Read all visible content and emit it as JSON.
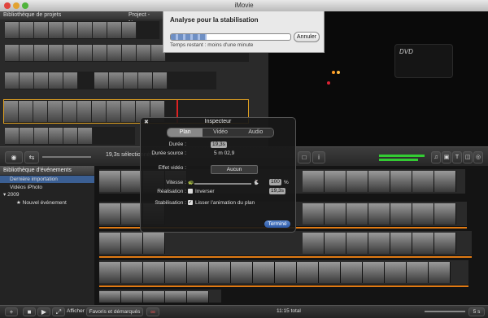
{
  "window": {
    "title": "iMovie"
  },
  "project_library": {
    "header": "Bibliothèque de projets",
    "project_name": "Project - Nouve..."
  },
  "viewer": {
    "dvd_label": "DVD"
  },
  "analysis": {
    "title": "Analyse pour la stabilisation",
    "progress": 0.3,
    "cancel_label": "Annuler",
    "remaining": "Temps restant : moins d'une minute"
  },
  "toolbar": {
    "selection": "19,3s sélectionné(e)"
  },
  "event_library": {
    "header": "Bibliothèque d'événements",
    "items": [
      {
        "label": "Dernière importation"
      },
      {
        "label": "Vidéos iPhoto"
      },
      {
        "label": "2009"
      },
      {
        "label": "Nouvel événement"
      }
    ]
  },
  "inspector": {
    "title": "Inspecteur",
    "tabs": [
      {
        "label": "Plan"
      },
      {
        "label": "Vidéo"
      },
      {
        "label": "Audio"
      }
    ],
    "duration_label": "Durée :",
    "duration_value": "19,3s",
    "source_duration_label": "Durée source :",
    "source_duration_value": "5 m 02,9",
    "video_effect_label": "Effet vidéo :",
    "video_effect_value": "Aucun",
    "speed_label": "Vitesse :",
    "speed_value": "100",
    "speed_unit": "%",
    "playback_label": "Réalisation :",
    "reverse_label": "Inverser",
    "playback_value": "19,3s",
    "stabilization_label": "Stabilisation :",
    "smooth_label": "Lisser l'animation du plan",
    "done_label": "Terminé"
  },
  "bottom_bar": {
    "show_label": "Afficher",
    "filter_value": "Favoris et démarqués",
    "total": "11:15 total",
    "zoom": "5 s"
  }
}
